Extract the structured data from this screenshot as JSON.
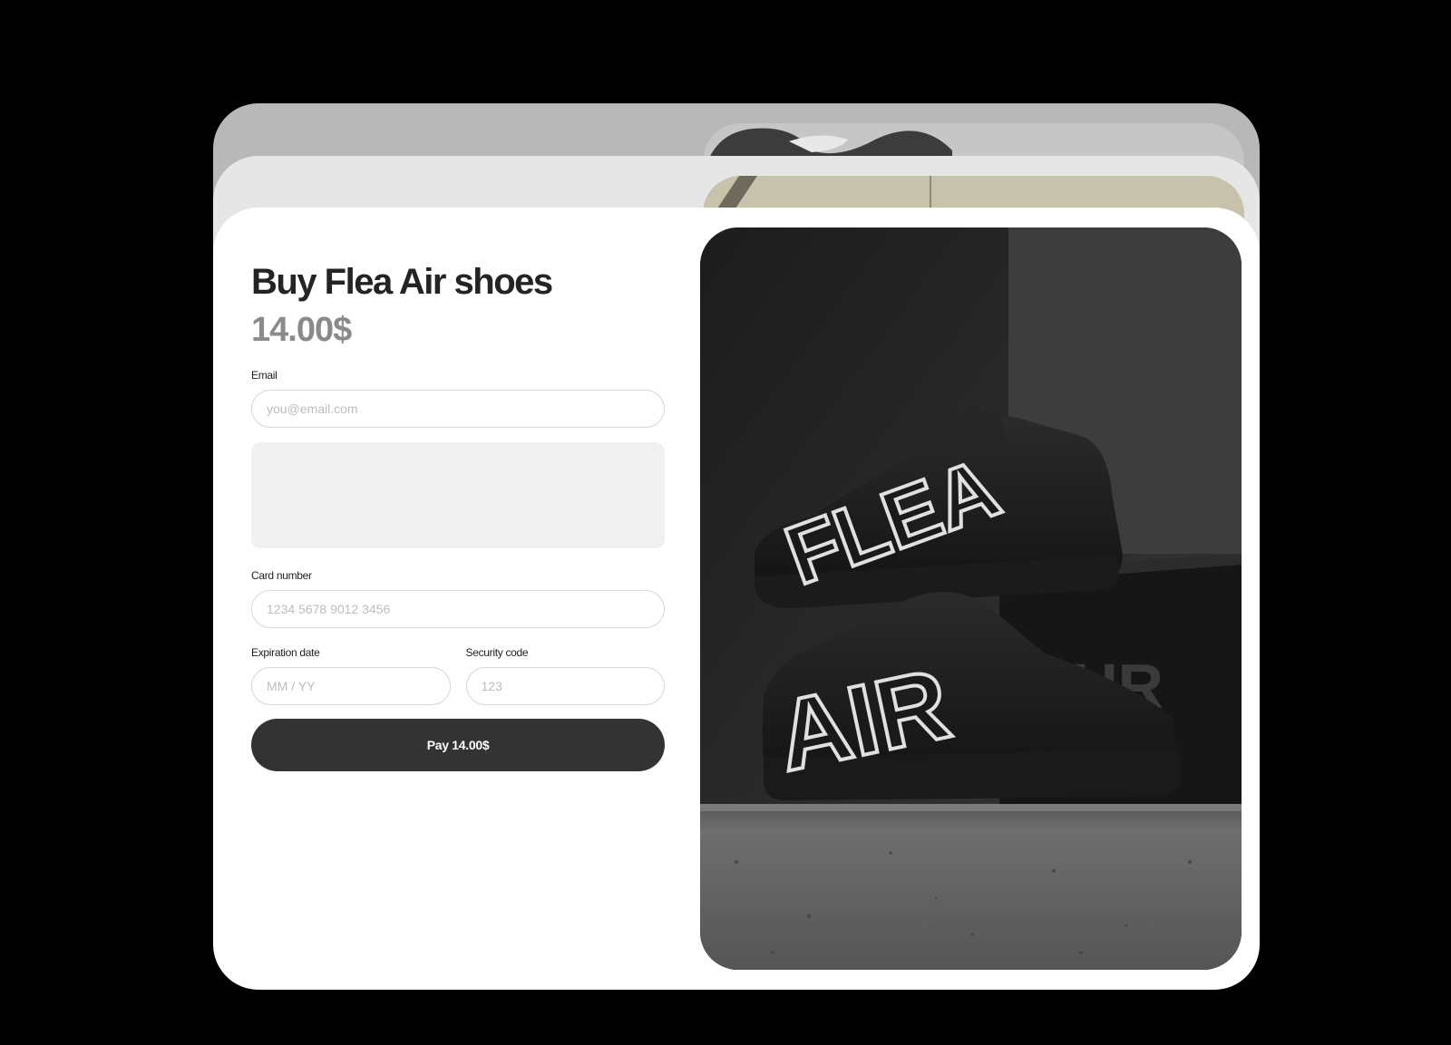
{
  "checkout": {
    "title": "Buy Flea Air shoes",
    "price": "14.00$",
    "email": {
      "label": "Email",
      "value": "",
      "placeholder": "you@email.com"
    },
    "card_number": {
      "label": "Card number",
      "value": "",
      "placeholder": "1234 5678 9012 3456"
    },
    "expiration": {
      "label": "Expiration date",
      "value": "",
      "placeholder": "MM / YY"
    },
    "security": {
      "label": "Security code",
      "value": "",
      "placeholder": "123"
    },
    "pay_label": "Pay 14.00$"
  },
  "product_image": {
    "upper_shoe_text": "FLEA",
    "lower_shoe_text": "AIR"
  },
  "colors": {
    "background": "#000000",
    "card": "#ffffff",
    "pay_button": "#333333",
    "price": "#8a8a8a"
  }
}
